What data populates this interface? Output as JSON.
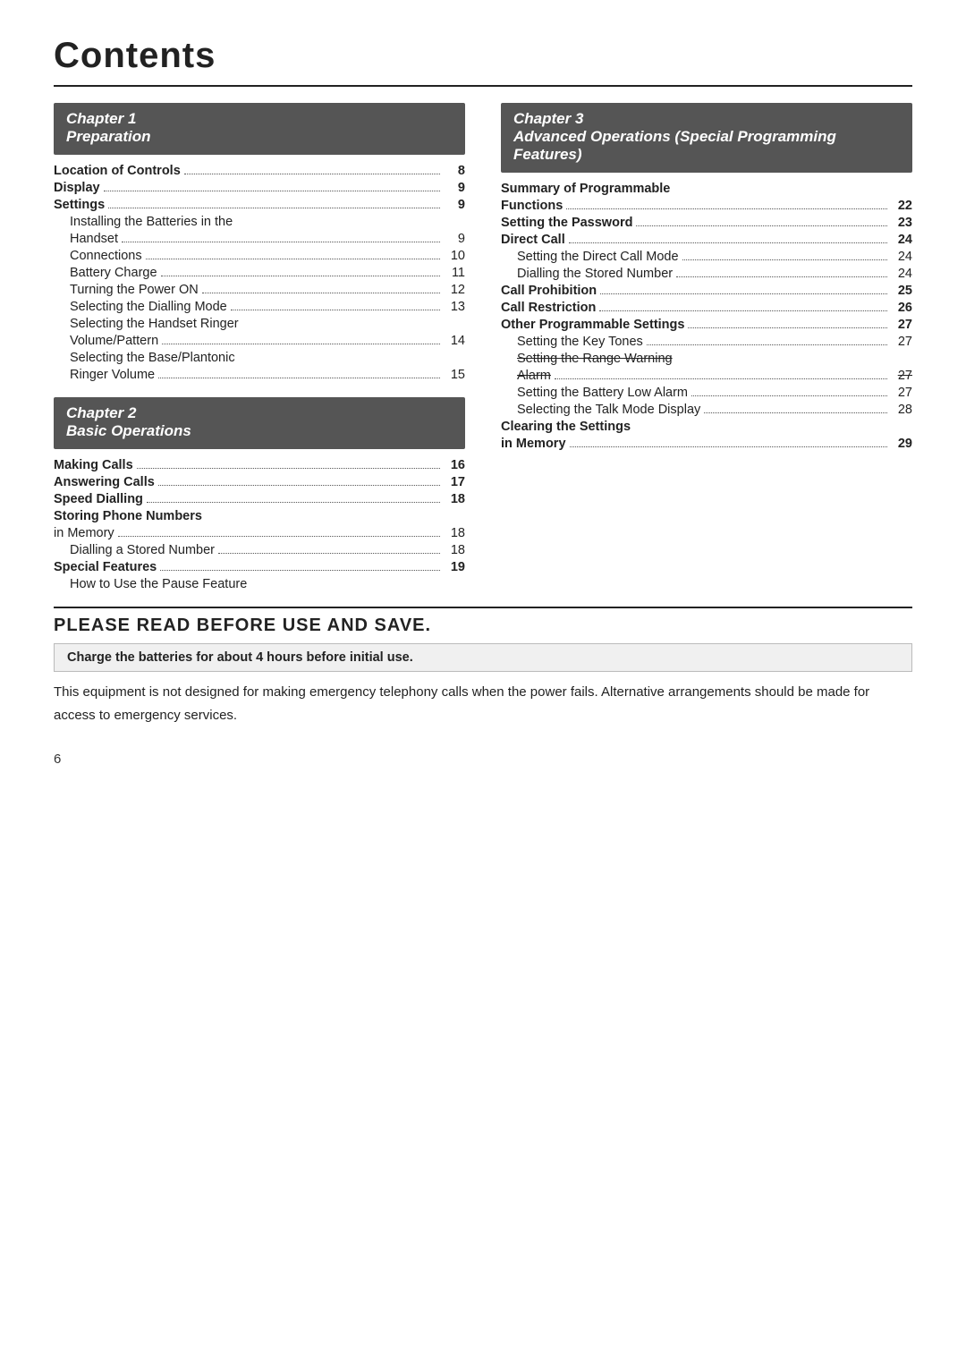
{
  "title": "Contents",
  "divider": true,
  "columns": {
    "left": {
      "chapters": [
        {
          "num": "Chapter 1",
          "title": "Preparation",
          "entries": [
            {
              "label": "Location of Controls ",
              "dots": true,
              "page": "8",
              "bold": true,
              "indent": 0
            },
            {
              "label": "Display ",
              "dots": true,
              "page": "9",
              "bold": true,
              "indent": 0
            },
            {
              "label": "Settings ",
              "dots": true,
              "page": "9",
              "bold": true,
              "indent": 0
            },
            {
              "label": "Installing the Batteries in the",
              "dots": false,
              "page": "",
              "bold": false,
              "indent": 1
            },
            {
              "label": "Handset ",
              "dots": true,
              "page": "9",
              "bold": false,
              "indent": 1
            },
            {
              "label": "Connections ",
              "dots": true,
              "page": "10",
              "bold": false,
              "indent": 1
            },
            {
              "label": "Battery Charge",
              "dots": true,
              "page": "11",
              "bold": false,
              "indent": 1
            },
            {
              "label": "Turning the Power ON",
              "dots": true,
              "page": "12",
              "bold": false,
              "indent": 1
            },
            {
              "label": "Selecting the Dialling Mode",
              "dots": true,
              "page": "13",
              "bold": false,
              "indent": 1
            },
            {
              "label": "Selecting the Handset Ringer",
              "dots": false,
              "page": "",
              "bold": false,
              "indent": 1
            },
            {
              "label": "Volume/Pattern",
              "dots": true,
              "page": "14",
              "bold": false,
              "indent": 1
            },
            {
              "label": "Selecting the Base/Plantonic",
              "dots": false,
              "page": "",
              "bold": false,
              "indent": 1
            },
            {
              "label": "Ringer Volume",
              "dots": true,
              "page": "15",
              "bold": false,
              "indent": 1
            }
          ]
        },
        {
          "num": "Chapter 2",
          "title": "Basic Operations",
          "entries": [
            {
              "label": "Making Calls ",
              "dots": true,
              "page": "16",
              "bold": true,
              "indent": 0
            },
            {
              "label": "Answering Calls",
              "dots": true,
              "page": "17",
              "bold": true,
              "indent": 0
            },
            {
              "label": "Speed Dialling ",
              "dots": true,
              "page": "18",
              "bold": true,
              "indent": 0
            },
            {
              "label": "Storing Phone Numbers",
              "dots": false,
              "page": "",
              "bold": true,
              "indent": 0
            },
            {
              "label": "in Memory ",
              "dots": true,
              "page": "18",
              "bold": false,
              "indent": 0
            },
            {
              "label": "Dialling a Stored Number",
              "dots": true,
              "page": "18",
              "bold": false,
              "indent": 1
            },
            {
              "label": "Special Features ",
              "dots": true,
              "page": "19",
              "bold": true,
              "indent": 0
            },
            {
              "label": "How to Use the Pause Feature",
              "dots": false,
              "page": "",
              "bold": false,
              "indent": 1
            }
          ]
        }
      ]
    },
    "right": {
      "chapters": [
        {
          "num": "Chapter 3",
          "title": "Advanced Operations (Special Programming Features)",
          "entries": [
            {
              "label": "Summary of Programmable",
              "dots": false,
              "page": "",
              "bold": true,
              "indent": 0
            },
            {
              "label": "Functions",
              "dots": true,
              "page": "22",
              "bold": true,
              "indent": 0
            },
            {
              "label": "Setting the Password ",
              "dots": true,
              "page": "23",
              "bold": true,
              "indent": 0
            },
            {
              "label": "Direct Call",
              "dots": true,
              "page": "24",
              "bold": true,
              "indent": 0
            },
            {
              "label": "Setting the Direct Call Mode ",
              "dots": true,
              "page": "24",
              "bold": false,
              "indent": 1
            },
            {
              "label": "Dialling the Stored Number",
              "dots": true,
              "page": "24",
              "bold": false,
              "indent": 1
            },
            {
              "label": "Call Prohibition ",
              "dots": true,
              "page": "25",
              "bold": true,
              "indent": 0
            },
            {
              "label": "Call Restriction ",
              "dots": true,
              "page": "26",
              "bold": true,
              "indent": 0
            },
            {
              "label": "Other Programmable Settings",
              "dots": true,
              "page": "27",
              "bold": true,
              "indent": 0
            },
            {
              "label": "Setting the Key Tones ",
              "dots": true,
              "page": "27",
              "bold": false,
              "indent": 1
            },
            {
              "label": "Setting the Range Warning",
              "dots": false,
              "page": "",
              "bold": false,
              "indent": 1,
              "strike": true
            },
            {
              "label": "Alarm ",
              "dots": true,
              "page": "27",
              "bold": false,
              "indent": 1,
              "strike": true
            },
            {
              "label": "Setting the Battery Low Alarm",
              "dots": true,
              "page": "27",
              "bold": false,
              "indent": 1
            },
            {
              "label": "Selecting the Talk Mode Display ",
              "dots": true,
              "page": "28",
              "bold": false,
              "indent": 1
            },
            {
              "label": "Clearing the Settings",
              "dots": false,
              "page": "",
              "bold": true,
              "indent": 0
            },
            {
              "label": "in Memory ",
              "dots": true,
              "page": "29",
              "bold": true,
              "indent": 0
            }
          ]
        }
      ]
    }
  },
  "please_read": "PLEASE READ BEFORE USE AND SAVE.",
  "charge_note": "Charge the batteries for about 4 hours before initial use.",
  "emergency_note": "This equipment is not designed for making emergency telephony calls when the power fails. Alternative arrangements should be made for access to emergency services.",
  "page_number": "6"
}
